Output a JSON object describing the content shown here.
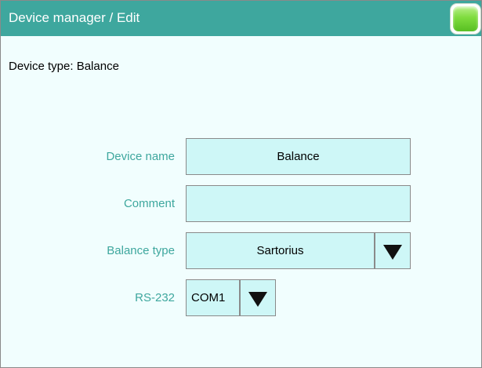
{
  "window": {
    "title": "Device manager / Edit",
    "home_button_icon": "home-icon"
  },
  "device_type_line": "Device type: Balance",
  "fields": {
    "device_name": {
      "label": "Device name",
      "value": "Balance"
    },
    "comment": {
      "label": "Comment",
      "value": ""
    },
    "balance_type": {
      "label": "Balance type",
      "value": "Sartorius"
    },
    "rs232": {
      "label": "RS-232",
      "value": "COM1"
    }
  },
  "colors": {
    "titlebar": "#3ea79e",
    "label_text": "#3ea79e",
    "field_bg": "#cef7f7",
    "window_bg": "#f1fefe"
  }
}
